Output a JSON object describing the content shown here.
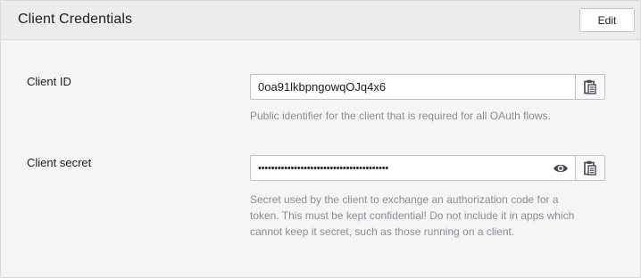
{
  "header": {
    "title": "Client Credentials",
    "edit_label": "Edit"
  },
  "client_id": {
    "label": "Client ID",
    "value": "0oa91lkbpngowqOJq4x6",
    "help": "Public identifier for the client that is required for all OAuth flows.",
    "copy_icon": "clipboard-icon"
  },
  "client_secret": {
    "label": "Client secret",
    "value": "••••••••••••••••••••••••••••••••••••••••",
    "help_lines": [
      "Secret used by the client to exchange an authorization code for a",
      "token. This must be kept confidential! Do not include it in apps which",
      "cannot keep it secret, such as those running on a client."
    ],
    "reveal_icon": "eye-icon",
    "copy_icon": "clipboard-icon"
  },
  "colors": {
    "header_bg": "#ececec",
    "panel_bg": "#f5f5f5",
    "border": "#c1c1c8",
    "help_text": "#8c8c96",
    "icon": "#4a4a52"
  }
}
